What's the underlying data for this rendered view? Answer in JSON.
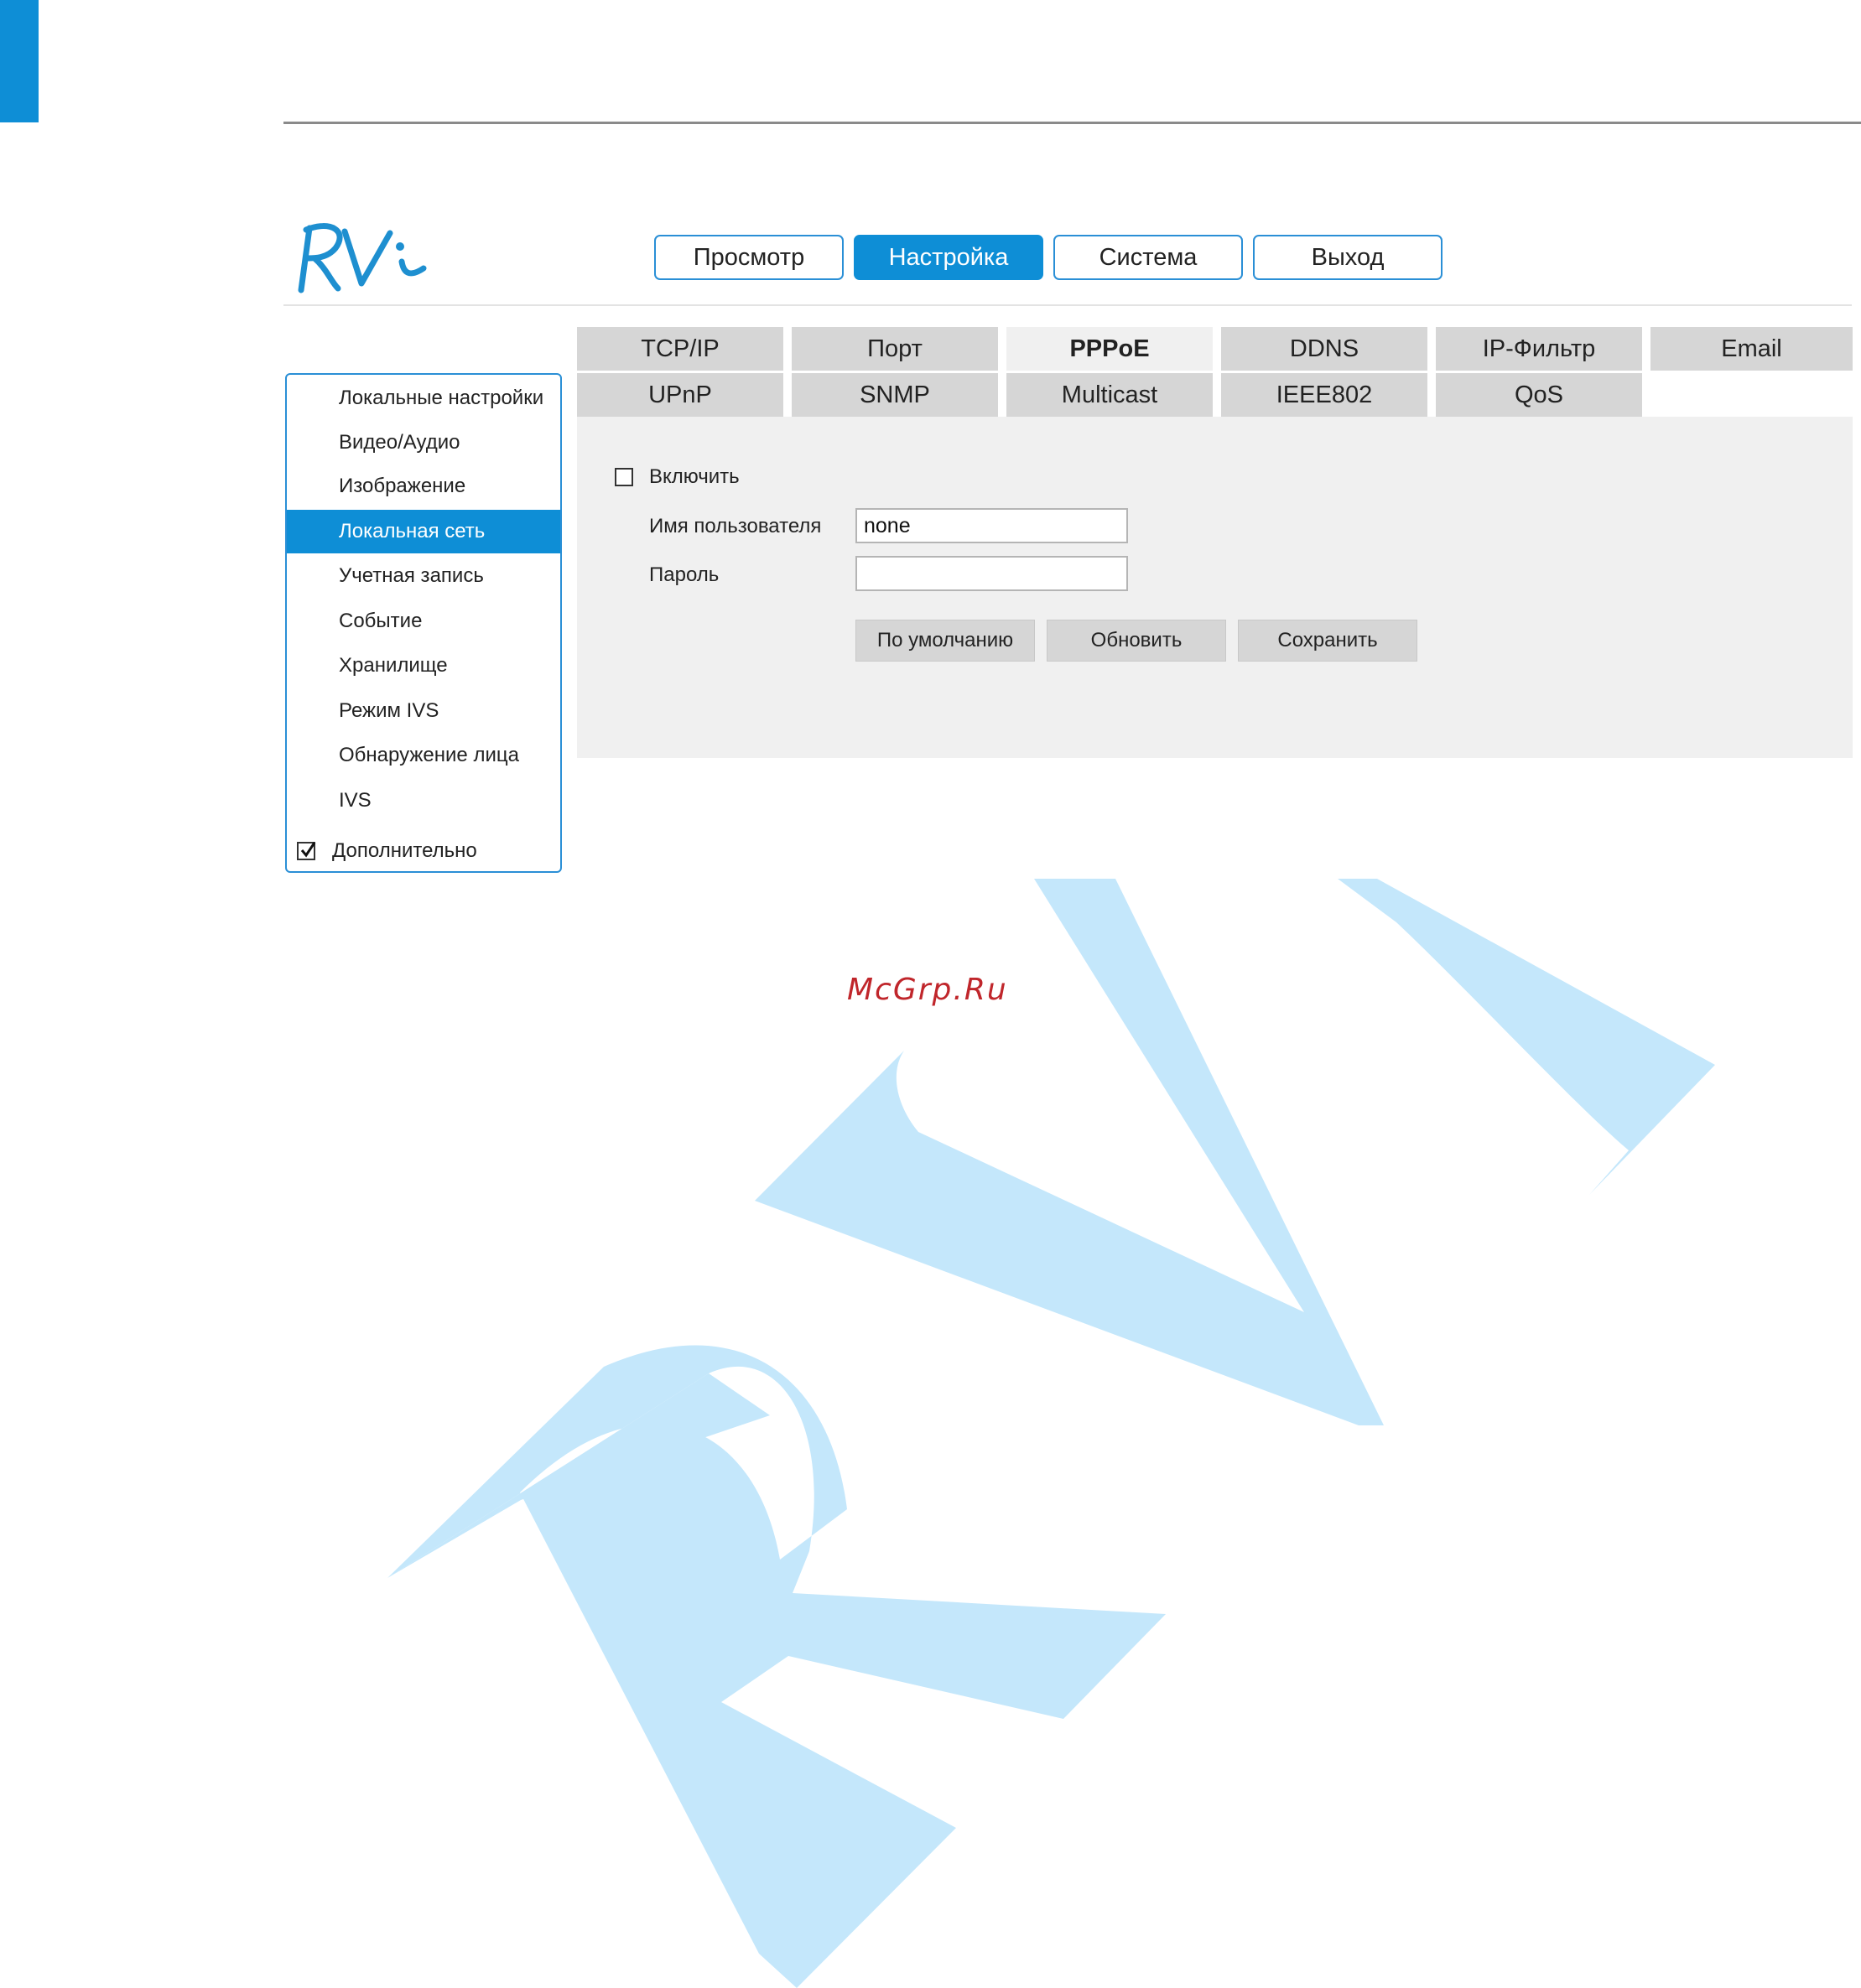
{
  "logo": {
    "text": "RVi",
    "icon": "rvi-logo"
  },
  "nav": {
    "items": [
      {
        "label": "Просмотр",
        "active": false
      },
      {
        "label": "Настройка",
        "active": true
      },
      {
        "label": "Система",
        "active": false
      },
      {
        "label": "Выход",
        "active": false
      }
    ]
  },
  "sidebar": {
    "items": [
      {
        "label": "Локальные настройки"
      },
      {
        "label": "Видео/Аудио"
      },
      {
        "label": "Изображение"
      },
      {
        "label": "Локальная сеть",
        "selected": true
      },
      {
        "label": "Учетная запись"
      },
      {
        "label": "Событие"
      },
      {
        "label": "Хранилище"
      },
      {
        "label": "Режим IVS"
      },
      {
        "label": "Обнаружение лица"
      },
      {
        "label": "IVS"
      }
    ],
    "more": {
      "label": "Дополнительно",
      "checked": true,
      "icon": "checkmark-icon"
    }
  },
  "tabs": {
    "row1": [
      "TCP/IP",
      "Порт",
      "PPPoE",
      "DDNS",
      "IP-Фильтр",
      "Email"
    ],
    "row2": [
      "UPnP",
      "SNMP",
      "Multicast",
      "IEEE802",
      "QoS"
    ],
    "active": "PPPoE"
  },
  "form": {
    "enable_label": "Включить",
    "enable_checked": false,
    "username_label": "Имя пользователя",
    "username_value": "none",
    "password_label": "Пароль",
    "password_value": ""
  },
  "buttons": {
    "default_label": "По умолчанию",
    "refresh_label": "Обновить",
    "save_label": "Сохранить"
  },
  "watermark": {
    "site": "McGrp.Ru",
    "big_text": "RVi",
    "color": "#c4e7fb"
  },
  "colors": {
    "accent": "#0e8ed6",
    "tab_bg": "#d6d6d6",
    "panel_bg": "#f0f0f0"
  }
}
